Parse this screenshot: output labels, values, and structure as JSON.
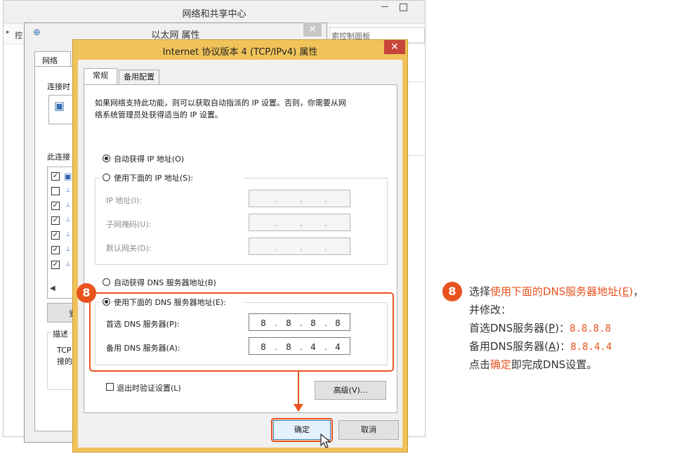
{
  "network_center": {
    "title": "网络和共享中心",
    "address_arrow": "▸",
    "address_text": "控",
    "search_text": "索控制面板"
  },
  "ethernet_props": {
    "title": "以太网 属性",
    "tab": "网络",
    "connect_label": "连接时",
    "uses_label": "此连接",
    "list_checks": [
      "✓",
      "",
      "✓",
      "✓",
      "✓",
      "✓",
      "✓"
    ],
    "install_button": "安",
    "desc_label": "描述",
    "desc_line1": "TCP",
    "desc_line2": "接的"
  },
  "ipv4_dialog": {
    "title": "Internet 协议版本 4 (TCP/IPv4) 属性",
    "tabs": [
      "常规",
      "备用配置"
    ],
    "intro_line1": "如果网络支持此功能，则可以获取自动指派的 IP 设置。否则，你需要从网",
    "intro_line2": "络系统管理员处获得适当的 IP 设置。",
    "ip_auto": "自动获得 IP 地址(O)",
    "ip_manual": "使用下面的 IP 地址(S):",
    "ip_address_label": "IP 地址(I):",
    "subnet_label": "子网掩码(U):",
    "gateway_label": "默认网关(D):",
    "dns_auto": "自动获得 DNS 服务器地址(B)",
    "dns_manual": "使用下面的 DNS 服务器地址(E):",
    "preferred_dns_label": "首选 DNS 服务器(P):",
    "preferred_dns": [
      "8",
      "8",
      "8",
      "8"
    ],
    "alternate_dns_label": "备用 DNS 服务器(A):",
    "alternate_dns": [
      "8",
      "8",
      "4",
      "4"
    ],
    "validate_on_exit": "退出时验证设置(L)",
    "advanced_button": "高级(V)...",
    "ok_button": "确定",
    "cancel_button": "取消"
  },
  "annotation": {
    "step": "8",
    "line1_prefix": "选择",
    "line1_red": "使用下面的DNS服务器地址(",
    "line1_red_key": "E",
    "line1_red_close": ")",
    "line1_suffix": "，",
    "line2": "并修改：",
    "line3_label": "首选DNS服务器(",
    "line3_key": "P",
    "line3_close": ")：",
    "line3_value": "8.8.8.8",
    "line4_label": "备用DNS服务器(",
    "line4_key": "A",
    "line4_close": ")：",
    "line4_value": "8.8.4.4",
    "line5_prefix": "点击",
    "line5_red": "确定",
    "line5_suffix": "即完成DNS设置。"
  },
  "colors": {
    "accent": "#e8531e",
    "dialog_frame": "#f0c35a",
    "close_red": "#c7453a"
  }
}
